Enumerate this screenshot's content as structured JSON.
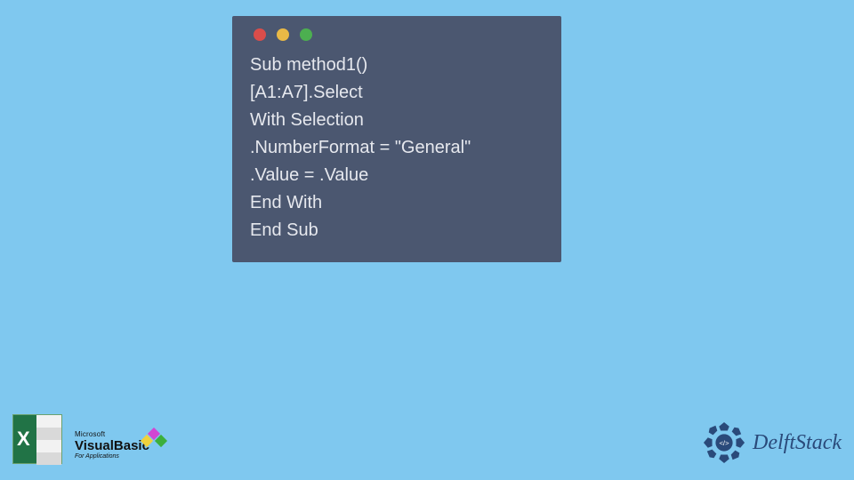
{
  "code_lines": [
    "Sub method1()",
    "[A1:A7].Select",
    "With Selection",
    ".NumberFormat = \"General\"",
    ".Value = .Value",
    "End With",
    "End Sub"
  ],
  "footer": {
    "excel_letter": "X",
    "vb": {
      "ms": "Microsoft",
      "name": "VisualBasic",
      "edition": "For Applications"
    },
    "delft": "DelftStack"
  }
}
